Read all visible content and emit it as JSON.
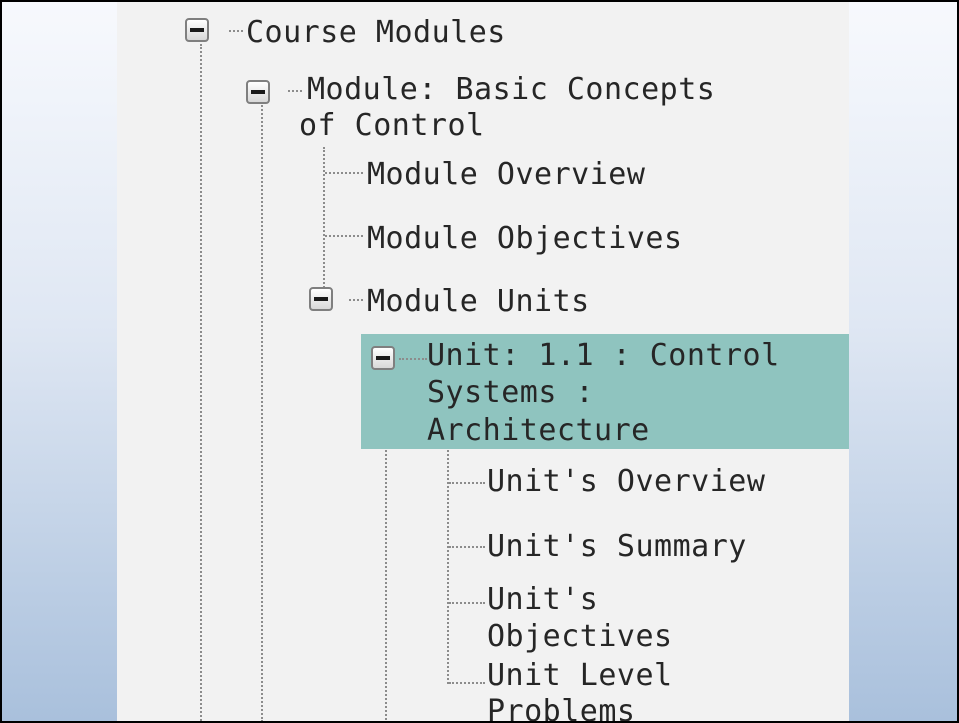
{
  "tree": {
    "course_modules": {
      "label": "Course Modules",
      "module": {
        "label_line1": "Module: Basic Concepts",
        "label_line2": "of Control",
        "items": [
          "Module Overview",
          "Module Objectives"
        ],
        "module_units": {
          "label": "Module Units",
          "unit": {
            "label_line1": "Unit: 1.1 : Control",
            "label_line2": "Systems :",
            "label_line3": "Architecture",
            "selected": true,
            "items": [
              {
                "line1": "Unit's Overview"
              },
              {
                "line1": "Unit's Summary"
              },
              {
                "line1": "Unit's",
                "line2": "Objectives"
              },
              {
                "line1": "Unit Level",
                "line2": "Problems"
              }
            ]
          }
        }
      }
    }
  },
  "colors": {
    "selection": "#8fc4bf",
    "panel_background": "#f2f2f2",
    "connector": "#8c8c8c",
    "text": "#262626"
  },
  "icons": {
    "expanded_toggle": "minus-box-icon"
  }
}
